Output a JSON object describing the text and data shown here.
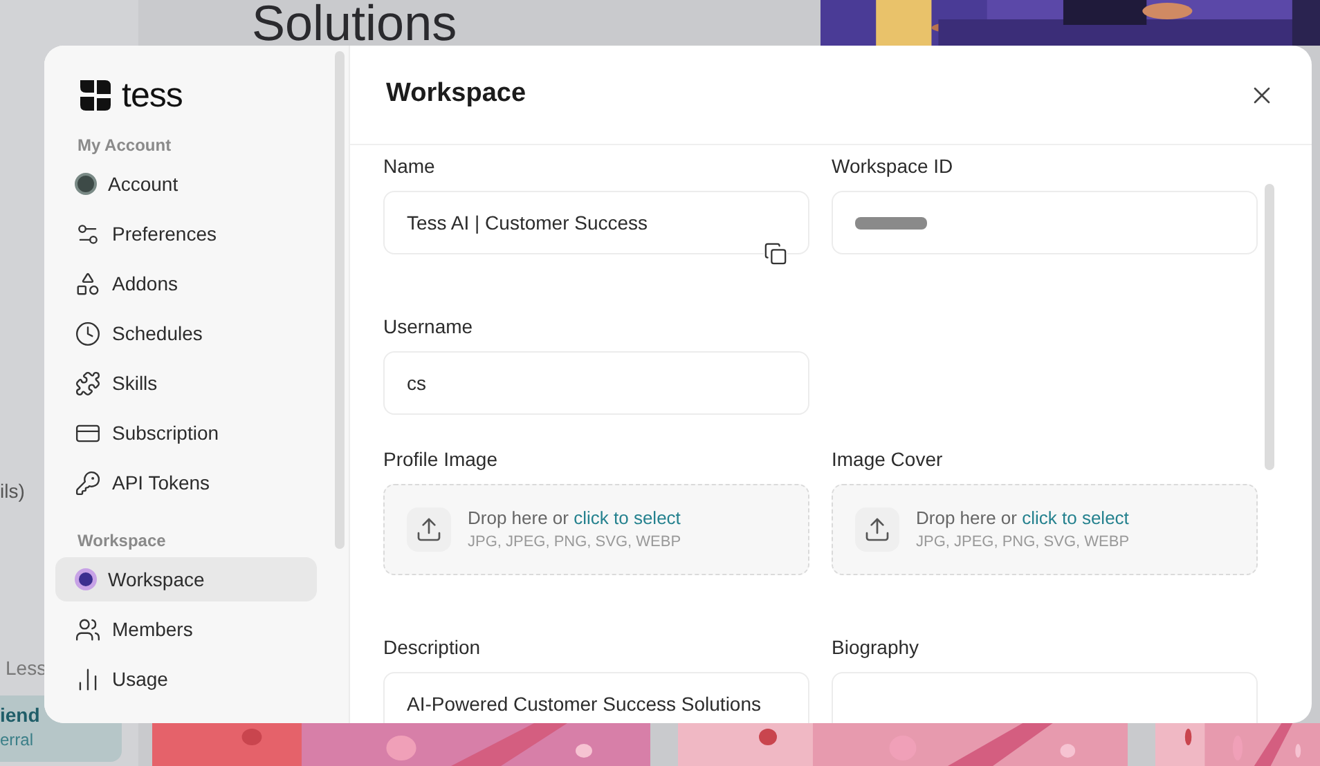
{
  "background": {
    "heading": "Solutions",
    "fragments": [
      "ils)",
      "Less"
    ],
    "card": {
      "title": "iend",
      "subtitle": "erral"
    }
  },
  "sidebar": {
    "logo": "tess",
    "sections": [
      {
        "title": "My Account",
        "items": [
          {
            "label": "Account",
            "kind": "avatar",
            "selected": false
          },
          {
            "label": "Preferences",
            "kind": "sliders",
            "selected": false
          },
          {
            "label": "Addons",
            "kind": "shapes",
            "selected": false
          },
          {
            "label": "Schedules",
            "kind": "clock",
            "selected": false
          },
          {
            "label": "Skills",
            "kind": "puzzle",
            "selected": false
          },
          {
            "label": "Subscription",
            "kind": "card",
            "selected": false
          },
          {
            "label": "API Tokens",
            "kind": "key",
            "selected": false
          }
        ]
      },
      {
        "title": "Workspace",
        "items": [
          {
            "label": "Workspace",
            "kind": "workspace",
            "selected": true
          },
          {
            "label": "Members",
            "kind": "users",
            "selected": false
          },
          {
            "label": "Usage",
            "kind": "chart",
            "selected": false
          }
        ]
      }
    ]
  },
  "dialog": {
    "title": "Workspace",
    "fields": [
      {
        "label": "Name",
        "kind": "text",
        "value": "Tess AI | Customer Success",
        "copy": true
      },
      {
        "label": "Workspace ID",
        "kind": "redacted"
      },
      {
        "label": "Username",
        "kind": "text",
        "value": "cs"
      },
      {
        "kind": "empty"
      },
      {
        "label": "Profile Image",
        "kind": "upload",
        "prompt": "Drop here or",
        "link": "click to select",
        "formats": "JPG, JPEG, PNG, SVG, WEBP"
      },
      {
        "label": "Image Cover",
        "kind": "upload",
        "prompt": "Drop here or",
        "link": "click to select",
        "formats": "JPG, JPEG, PNG, SVG, WEBP"
      },
      {
        "label": "Description",
        "kind": "text",
        "value": "AI-Powered Customer Success Solutions"
      },
      {
        "label": "Biography",
        "kind": "text"
      }
    ]
  }
}
